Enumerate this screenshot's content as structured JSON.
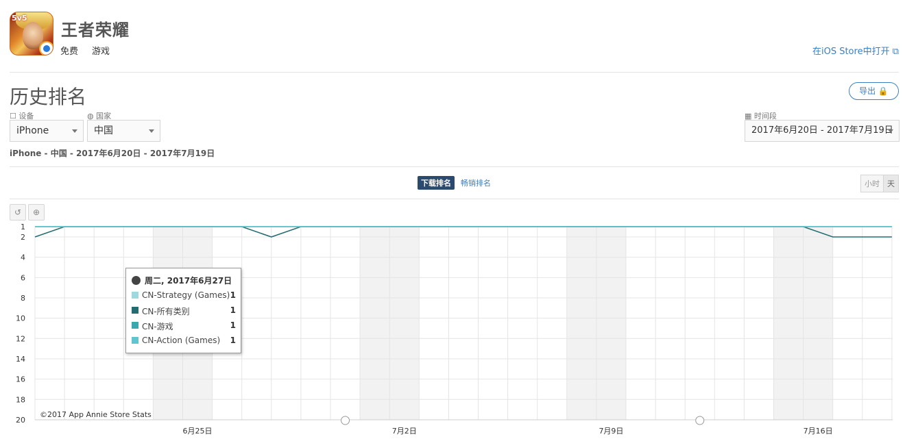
{
  "app": {
    "name": "王者荣耀",
    "price": "免费",
    "genre": "游戏",
    "store_link": "在iOS Store中打开 ⧉"
  },
  "section": {
    "title": "历史排名",
    "export_label": "导出 🔒"
  },
  "filters": {
    "device_label": "☐ 设备",
    "device_value": "iPhone",
    "country_label": "◍ 国家",
    "country_value": "中国",
    "period_label": "▦ 时间段",
    "period_value": "2017年6月20日 - 2017年7月19日"
  },
  "summary": "iPhone - 中国 - 2017年6月20日 - 2017年7月19日",
  "tabs": [
    {
      "label": "下载排名",
      "active": true
    },
    {
      "label": "畅销排名",
      "active": false
    }
  ],
  "granularity": [
    {
      "label": "小时",
      "active": false
    },
    {
      "label": "天",
      "active": true
    }
  ],
  "tools": {
    "reset_icon": "↺",
    "zoom_icon": "⊕"
  },
  "chart_data": {
    "type": "line",
    "y_reversed": true,
    "ylim": [
      1,
      20
    ],
    "y_ticks": [
      1,
      2,
      4,
      6,
      8,
      10,
      12,
      14,
      16,
      18,
      20
    ],
    "x": [
      "2017-06-20",
      "2017-06-21",
      "2017-06-22",
      "2017-06-23",
      "2017-06-24",
      "2017-06-25",
      "2017-06-26",
      "2017-06-27",
      "2017-06-28",
      "2017-06-29",
      "2017-06-30",
      "2017-07-01",
      "2017-07-02",
      "2017-07-03",
      "2017-07-04",
      "2017-07-05",
      "2017-07-06",
      "2017-07-07",
      "2017-07-08",
      "2017-07-09",
      "2017-07-10",
      "2017-07-11",
      "2017-07-12",
      "2017-07-13",
      "2017-07-14",
      "2017-07-15",
      "2017-07-16",
      "2017-07-17",
      "2017-07-18",
      "2017-07-19"
    ],
    "x_tick_labels": [
      {
        "date": "2017-06-25",
        "label": "6月25日"
      },
      {
        "date": "2017-07-02",
        "label": "7月2日"
      },
      {
        "date": "2017-07-09",
        "label": "7月9日"
      },
      {
        "date": "2017-07-16",
        "label": "7月16日"
      }
    ],
    "weekend_dates": [
      "2017-06-24",
      "2017-06-25",
      "2017-07-01",
      "2017-07-02",
      "2017-07-08",
      "2017-07-09",
      "2017-07-15",
      "2017-07-16"
    ],
    "marker_dates": [
      "2017-06-30",
      "2017-07-12"
    ],
    "series": [
      {
        "name": "CN-Strategy (Games)",
        "color": "#9fd9df",
        "values": [
          1,
          1,
          1,
          1,
          1,
          1,
          1,
          1,
          1,
          1,
          1,
          1,
          1,
          1,
          1,
          1,
          1,
          1,
          1,
          1,
          1,
          1,
          1,
          1,
          1,
          1,
          1,
          1,
          1,
          1
        ]
      },
      {
        "name": "CN-所有类别",
        "color": "#236d70",
        "values": [
          2,
          1,
          1,
          1,
          1,
          1,
          1,
          1,
          2,
          1,
          1,
          1,
          1,
          1,
          1,
          1,
          1,
          1,
          1,
          1,
          1,
          1,
          1,
          1,
          1,
          1,
          1,
          2,
          2,
          2
        ]
      },
      {
        "name": "CN-游戏",
        "color": "#3aa8ae",
        "values": [
          1,
          1,
          1,
          1,
          1,
          1,
          1,
          1,
          1,
          1,
          1,
          1,
          1,
          1,
          1,
          1,
          1,
          1,
          1,
          1,
          1,
          1,
          1,
          1,
          1,
          1,
          1,
          1,
          1,
          1
        ]
      },
      {
        "name": "CN-Action (Games)",
        "color": "#5ec6cc",
        "values": [
          1,
          1,
          1,
          1,
          1,
          1,
          1,
          1,
          1,
          1,
          1,
          1,
          1,
          1,
          1,
          1,
          1,
          1,
          1,
          1,
          1,
          1,
          1,
          1,
          1,
          1,
          1,
          1,
          1,
          1
        ]
      }
    ],
    "tooltip": {
      "title": "周二, 2017年6月27日",
      "rows": [
        {
          "name": "CN-Strategy (Games)",
          "value": "1"
        },
        {
          "name": "CN-所有类别",
          "value": "1"
        },
        {
          "name": "CN-游戏",
          "value": "1"
        },
        {
          "name": "CN-Action (Games)",
          "value": "1"
        }
      ]
    },
    "copyright": "©2017 App Annie Store Stats"
  }
}
